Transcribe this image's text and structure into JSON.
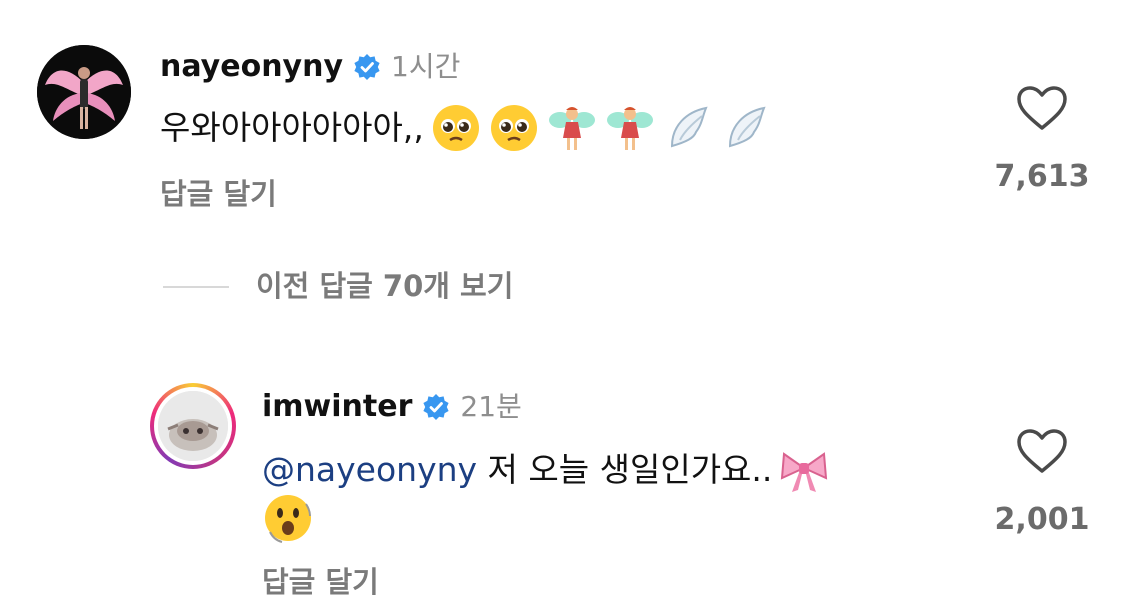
{
  "comments": [
    {
      "username": "nayeonyny",
      "time": "1시간",
      "text": "우와아아아아아아,,",
      "emojis": [
        "pleading-face",
        "pleading-face",
        "fairy",
        "fairy",
        "wing",
        "wing"
      ],
      "reply_label": "답글 달기",
      "likes": "7,613"
    }
  ],
  "view_replies": "이전 답글 70개 보기",
  "reply": {
    "username": "imwinter",
    "time": "21분",
    "mention": "@nayeonyny",
    "text": " 저 오늘 생일인가요..",
    "emojis": [
      "ribbon",
      "astonished-face"
    ],
    "reply_label": "답글 달기",
    "likes": "2,001"
  },
  "colors": {
    "verified": "#3897f0",
    "mention": "#1c3f82",
    "muted": "#8e8e8e"
  }
}
